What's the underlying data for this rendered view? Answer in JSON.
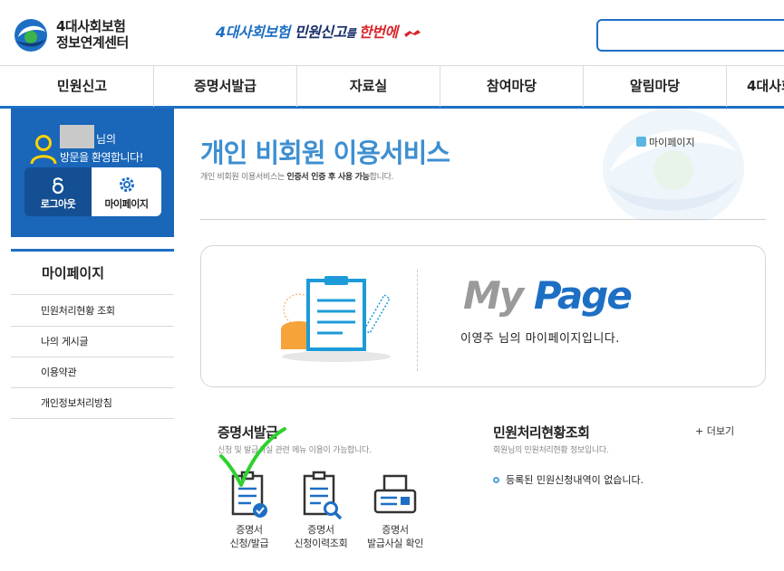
{
  "header": {
    "logo_line1": "4대사회보험",
    "logo_line2": "정보연계센터",
    "slogan_part1": "4대사회보험",
    "slogan_part2": "민원신고",
    "slogan_part3": "를 ",
    "slogan_part4": "한번에"
  },
  "nav": {
    "items": [
      "민원신고",
      "증명서발급",
      "자료실",
      "참여마당",
      "알림마당",
      "4대사회"
    ]
  },
  "user": {
    "nim_suffix": "님의",
    "welcome": "방문을 환영합니다!",
    "logout_label": "로그아웃",
    "mypage_label": "마이페이지"
  },
  "sidebar": {
    "title": "마이페이지",
    "items": [
      "민원처리현황 조회",
      "나의 게시글",
      "이용약관",
      "개인정보처리방침"
    ]
  },
  "main": {
    "title": "개인 비회원 이용서비스",
    "subtitle_pre": "개인 비회원 이용서비스는 ",
    "subtitle_bold": "인증서 인증 후 사용 가능",
    "subtitle_post": "합니다.",
    "breadcrumb": "마이페이지"
  },
  "mypage_card": {
    "logo_my": "My",
    "logo_page": "Page",
    "message": "이영주 님의 마이페이지입니다."
  },
  "cert_section": {
    "title": "증명서발급",
    "subtitle": "신청 및 발급사실 관련 메뉴 이용이 가능합니다.",
    "buttons": [
      {
        "line1": "증명서",
        "line2": "신청/발급"
      },
      {
        "line1": "증명서",
        "line2": "신청이력조회"
      },
      {
        "line1": "증명서",
        "line2": "발급사실 확인"
      }
    ]
  },
  "status_section": {
    "title": "민원처리현황조회",
    "subtitle": "회원님의 민원처리현황 정보입니다.",
    "more": "+ 더보기",
    "empty_message": "등록된 민원신청내역이 없습니다."
  },
  "colors": {
    "primary": "#1d6fc4",
    "userbox": "#1a66b8",
    "title_blue": "#3e8fd1",
    "annotation_green": "#2ed12e"
  }
}
